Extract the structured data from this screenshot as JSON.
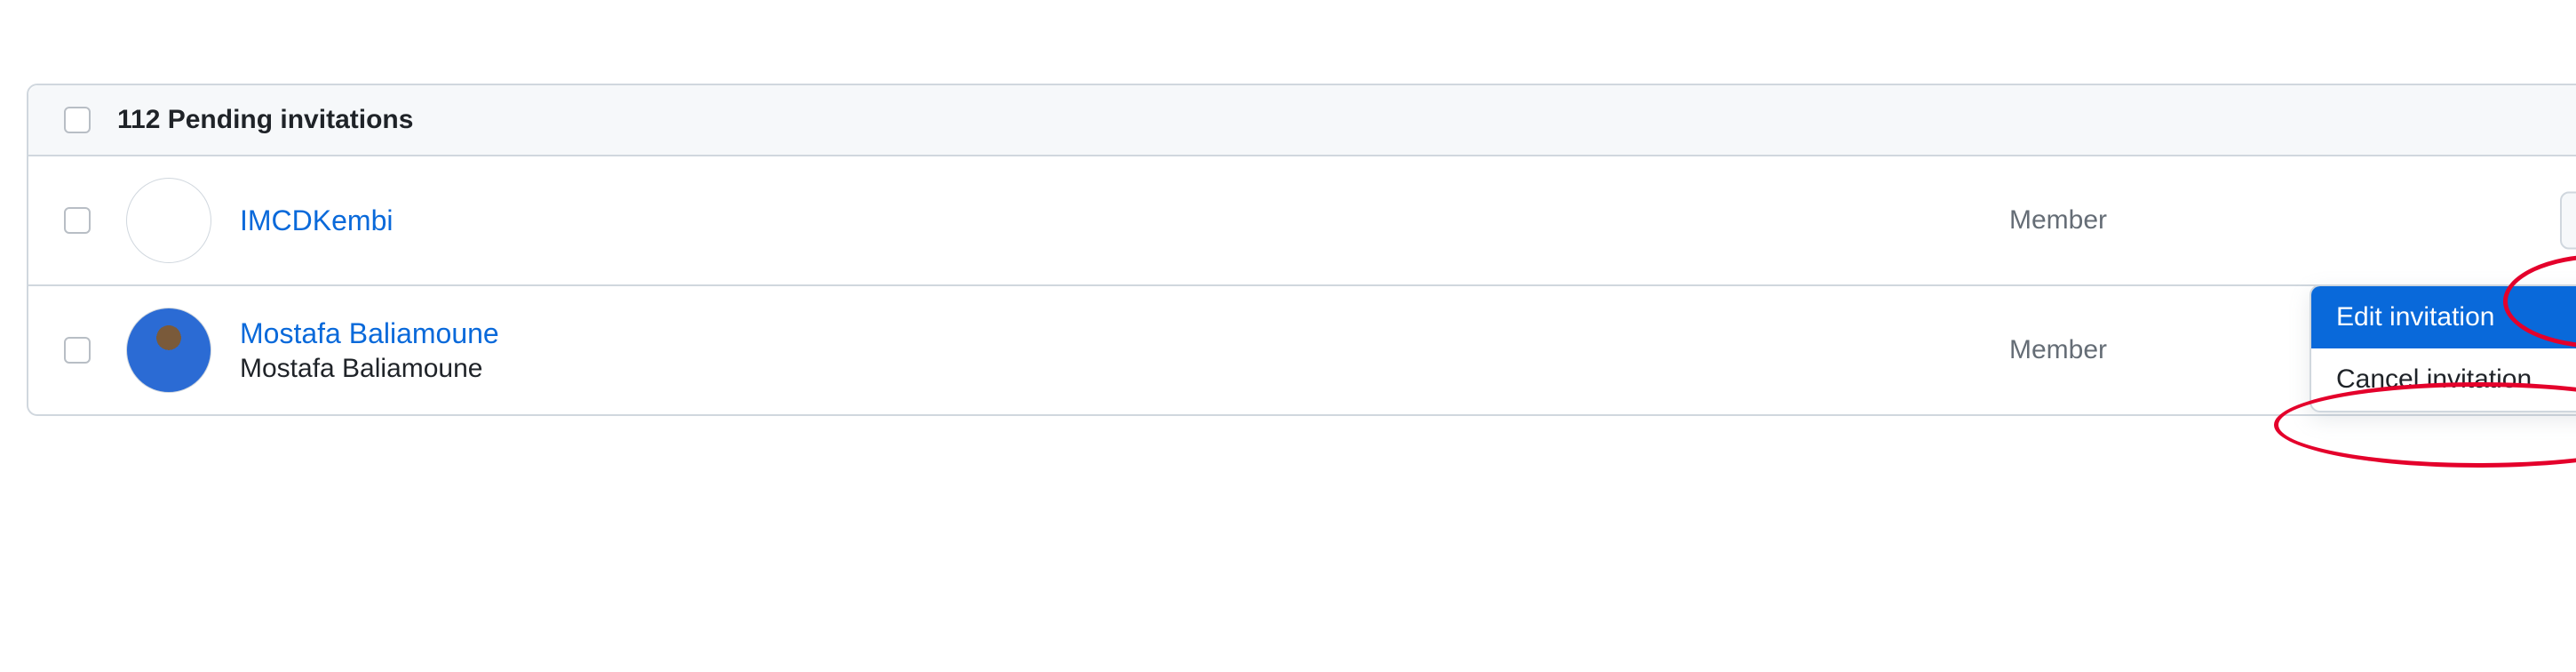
{
  "header": {
    "title": "112 Pending invitations"
  },
  "rows": [
    {
      "username": "IMCDKembi",
      "display_name": "",
      "role": "Member",
      "avatar_style": "pixel"
    },
    {
      "username": "Mostafa Baliamoune",
      "display_name": "Mostafa Baliamoune",
      "role": "Member",
      "avatar_style": "photo"
    }
  ],
  "dropdown": {
    "items": [
      {
        "label": "Edit invitation",
        "selected": true
      },
      {
        "label": "Cancel invitation",
        "selected": false
      }
    ]
  }
}
